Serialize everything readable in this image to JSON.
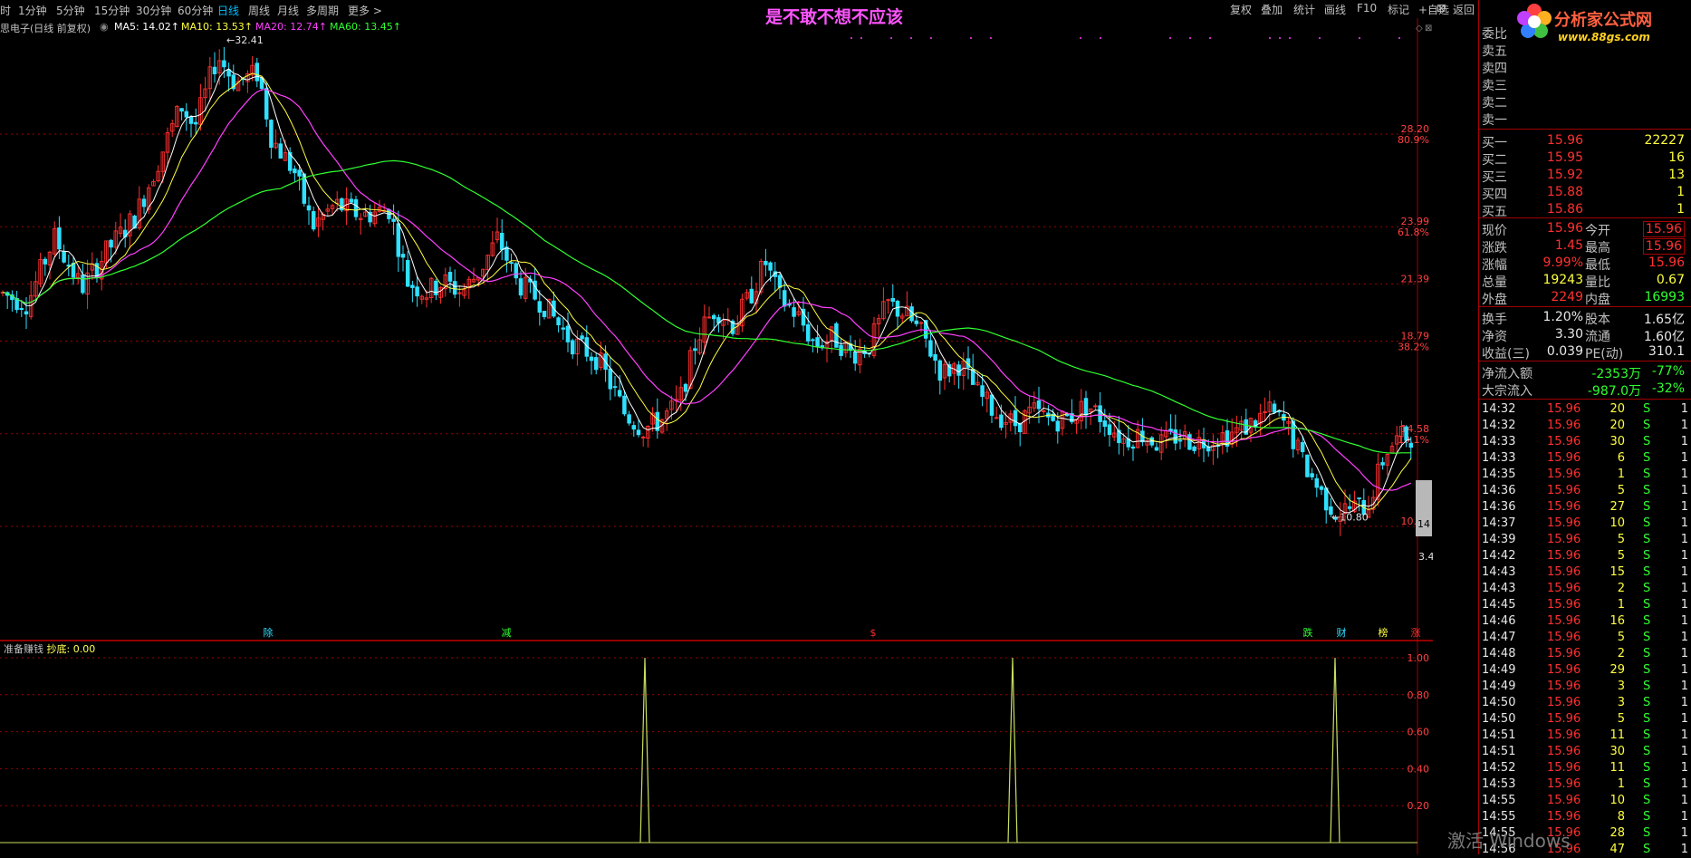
{
  "timeframes": [
    {
      "label": "时",
      "active": false
    },
    {
      "label": "1分钟",
      "active": false
    },
    {
      "label": "5分钟",
      "active": false
    },
    {
      "label": "15分钟",
      "active": false
    },
    {
      "label": "30分钟",
      "active": false
    },
    {
      "label": "60分钟",
      "active": false
    },
    {
      "label": "日线",
      "active": true
    },
    {
      "label": "周线",
      "active": false
    },
    {
      "label": "月线",
      "active": false
    },
    {
      "label": "多周期",
      "active": false
    },
    {
      "label": "更多 >",
      "active": false
    }
  ],
  "banner_title": "是不敢不想不应该",
  "toolbar": [
    "复权",
    "叠加",
    "统计",
    "画线",
    "F10",
    "标记",
    "+自选",
    "返回"
  ],
  "stock_header": "思电子(日线 前复权)",
  "ma_labels": [
    {
      "text": "MA5: 14.02↑",
      "color": "#ffffff"
    },
    {
      "text": "MA10: 13.53↑",
      "color": "#ffff40"
    },
    {
      "text": "MA20: 12.74↑",
      "color": "#ff40ff"
    },
    {
      "text": "MA60: 13.45↑",
      "color": "#30ff30"
    }
  ],
  "price_axis": [
    {
      "price": "28.20",
      "pct": "80.9%"
    },
    {
      "price": "23.99",
      "pct": "61.8%"
    },
    {
      "price": "21.39",
      "pct": ""
    },
    {
      "price": "18.79",
      "pct": "38.2%"
    },
    {
      "price": "14.58",
      "pct": "19.1%"
    },
    {
      "price": "10.37",
      "pct": ""
    }
  ],
  "annotations": {
    "high": "32.41",
    "low": "10.80",
    "last_box": "14",
    "last_price": "3.4"
  },
  "event_markers": [
    {
      "label": "除",
      "color": "#30e0ff"
    },
    {
      "label": "减",
      "color": "#30ff30"
    },
    {
      "label": "$",
      "color": "#ff3030"
    },
    {
      "label": "跌",
      "color": "#30ff30"
    },
    {
      "label": "财",
      "color": "#30e0ff"
    },
    {
      "label": "榜",
      "color": "#ffff40"
    },
    {
      "label": "涨",
      "color": "#ff3030"
    }
  ],
  "sub_indicator": {
    "name": "准备赚钱",
    "series": "抄底",
    "value": "0.00"
  },
  "sub_axis": [
    "1.00",
    "0.80",
    "0.60",
    "0.40",
    "0.20"
  ],
  "right_panel": {
    "logo_text": "分析家公式网",
    "logo_url": "www.88gs.com",
    "weibi_label": "委比",
    "sells": [
      "卖五",
      "卖四",
      "卖三",
      "卖二",
      "卖一"
    ],
    "buys": [
      {
        "label": "买一",
        "price": "15.96",
        "vol": "22227"
      },
      {
        "label": "买二",
        "price": "15.95",
        "vol": "16"
      },
      {
        "label": "买三",
        "price": "15.92",
        "vol": "13"
      },
      {
        "label": "买四",
        "price": "15.88",
        "vol": "1"
      },
      {
        "label": "买五",
        "price": "15.86",
        "vol": "1"
      }
    ],
    "quote": [
      {
        "l1": "现价",
        "v1": "15.96",
        "c1": "red",
        "l2": "今开",
        "v2": "15.96",
        "c2": "red",
        "box": true
      },
      {
        "l1": "涨跌",
        "v1": "1.45",
        "c1": "red",
        "l2": "最高",
        "v2": "15.96",
        "c2": "red",
        "box": true
      },
      {
        "l1": "涨幅",
        "v1": "9.99%",
        "c1": "red",
        "l2": "最低",
        "v2": "15.96",
        "c2": "red",
        "box": false
      },
      {
        "l1": "总量",
        "v1": "19243",
        "c1": "yel",
        "l2": "量比",
        "v2": "0.67",
        "c2": "yel",
        "box": false
      },
      {
        "l1": "外盘",
        "v1": "2249",
        "c1": "red",
        "l2": "内盘",
        "v2": "16993",
        "c2": "grn",
        "box": false
      }
    ],
    "fundamentals": [
      {
        "l1": "换手",
        "v1": "1.20%",
        "l2": "股本",
        "v2": "1.65亿"
      },
      {
        "l1": "净资",
        "v1": "3.30",
        "l2": "流通",
        "v2": "1.60亿"
      },
      {
        "l1": "收益(三)",
        "v1": "0.039",
        "l2": "PE(动)",
        "v2": "310.1"
      }
    ],
    "flows": [
      {
        "label": "净流入额",
        "val": "-2353万",
        "pct": "-77%"
      },
      {
        "label": "大宗流入",
        "val": "-987.0万",
        "pct": "-32%"
      }
    ],
    "ticks": [
      [
        "14:32",
        "15.96",
        "20",
        "S",
        "1"
      ],
      [
        "14:32",
        "15.96",
        "20",
        "S",
        "1"
      ],
      [
        "14:33",
        "15.96",
        "30",
        "S",
        "1"
      ],
      [
        "14:33",
        "15.96",
        "6",
        "S",
        "1"
      ],
      [
        "14:35",
        "15.96",
        "1",
        "S",
        "1"
      ],
      [
        "14:36",
        "15.96",
        "5",
        "S",
        "1"
      ],
      [
        "14:36",
        "15.96",
        "27",
        "S",
        "1"
      ],
      [
        "14:37",
        "15.96",
        "10",
        "S",
        "1"
      ],
      [
        "14:39",
        "15.96",
        "5",
        "S",
        "1"
      ],
      [
        "14:42",
        "15.96",
        "5",
        "S",
        "1"
      ],
      [
        "14:43",
        "15.96",
        "15",
        "S",
        "1"
      ],
      [
        "14:43",
        "15.96",
        "2",
        "S",
        "1"
      ],
      [
        "14:45",
        "15.96",
        "1",
        "S",
        "1"
      ],
      [
        "14:46",
        "15.96",
        "16",
        "S",
        "1"
      ],
      [
        "14:47",
        "15.96",
        "5",
        "S",
        "1"
      ],
      [
        "14:48",
        "15.96",
        "2",
        "S",
        "1"
      ],
      [
        "14:49",
        "15.96",
        "29",
        "S",
        "1"
      ],
      [
        "14:49",
        "15.96",
        "3",
        "S",
        "1"
      ],
      [
        "14:50",
        "15.96",
        "3",
        "S",
        "1"
      ],
      [
        "14:50",
        "15.96",
        "5",
        "S",
        "1"
      ],
      [
        "14:51",
        "15.96",
        "11",
        "S",
        "1"
      ],
      [
        "14:51",
        "15.96",
        "30",
        "S",
        "1"
      ],
      [
        "14:52",
        "15.96",
        "11",
        "S",
        "1"
      ],
      [
        "14:53",
        "15.96",
        "1",
        "S",
        "1"
      ],
      [
        "14:55",
        "15.96",
        "10",
        "S",
        "1"
      ],
      [
        "14:55",
        "15.96",
        "8",
        "S",
        "1"
      ],
      [
        "14:55",
        "15.96",
        "28",
        "S",
        "1"
      ],
      [
        "14:56",
        "15.96",
        "47",
        "S",
        "1"
      ]
    ]
  },
  "watermark": "激活 Windows",
  "colors": {
    "up": "#ff3030",
    "down": "#30e0ff",
    "ma5": "#ffffff",
    "ma10": "#ffff40",
    "ma20": "#ff40ff",
    "ma60": "#30ff30",
    "grid": "#a00000"
  }
}
